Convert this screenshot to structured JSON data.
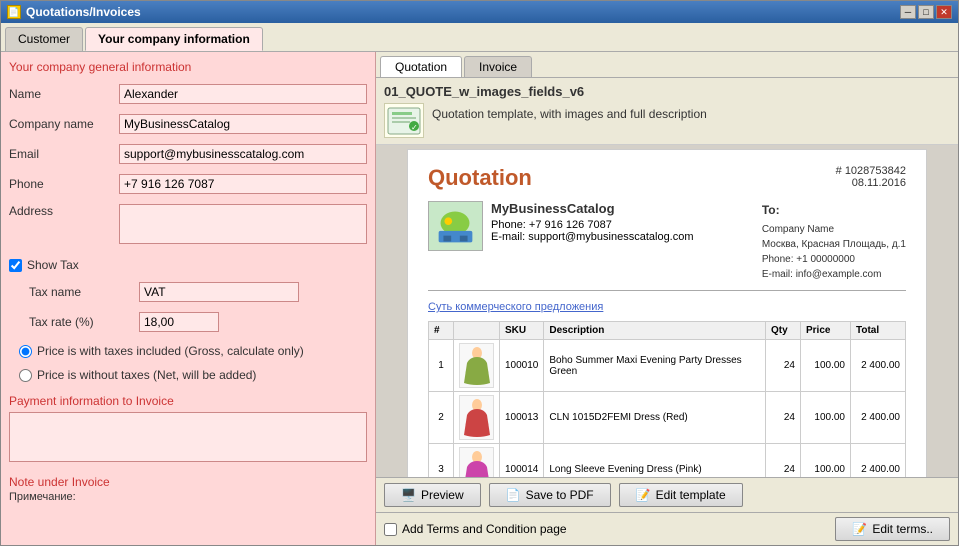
{
  "window": {
    "title": "Quotations/Invoices",
    "icon": "💼"
  },
  "outer_tabs": [
    {
      "label": "Customer",
      "active": false
    },
    {
      "label": "Your company information",
      "active": true
    }
  ],
  "left_panel": {
    "section_title": "Your company general information",
    "fields": [
      {
        "label": "Name",
        "value": "Alexander",
        "placeholder": ""
      },
      {
        "label": "Company name",
        "value": "MyBusinessCatalog",
        "placeholder": ""
      },
      {
        "label": "Email",
        "value": "support@mybusinesscatalog.com",
        "placeholder": ""
      },
      {
        "label": "Phone",
        "value": "+7 916 126 7087",
        "placeholder": ""
      },
      {
        "label": "Address",
        "value": "",
        "placeholder": "",
        "multiline": true
      }
    ],
    "show_tax_label": "Show Tax",
    "show_tax_checked": true,
    "tax_name_label": "Tax name",
    "tax_name_value": "VAT",
    "tax_rate_label": "Tax rate (%)",
    "tax_rate_value": "18,00",
    "radio_options": [
      {
        "label": "Price is with taxes included (Gross, calculate only)",
        "checked": true
      },
      {
        "label": "Price is without taxes (Net, will be added)",
        "checked": false
      }
    ],
    "payment_label": "Payment information to Invoice",
    "payment_value": "",
    "note_label": "Note under Invoice",
    "note_sublabel": "Примечание:"
  },
  "right_panel": {
    "tabs": [
      {
        "label": "Quotation",
        "active": true
      },
      {
        "label": "Invoice",
        "active": false
      }
    ],
    "template_name": "01_QUOTE_w_images_fields_v6",
    "template_description": "Quotation template, with images and full description",
    "document": {
      "title": "Quotation",
      "number": "# 1028753842",
      "date": "08.11.2016",
      "company_name": "MyBusinessCatalog",
      "company_phone": "Phone: +7 916 126 7087",
      "company_email": "E-mail: support@mybusinesscatalog.com",
      "to_label": "To:",
      "to_company": "Company Name",
      "to_address": "Москва, Красная Площадь, д.1",
      "to_phone": "Phone: +1 00000000",
      "to_email": "E-mail: info@example.com",
      "subject": "Суть коммерческого предложения",
      "table_headers": [
        "#",
        "SKU",
        "Description",
        "Qty",
        "Price",
        "Total"
      ],
      "items": [
        {
          "num": "1",
          "sku": "100010",
          "desc": "Boho Summer Maxi Evening Party Dresses Green",
          "qty": "24",
          "price": "100.00",
          "total": "2 400.00"
        },
        {
          "num": "2",
          "sku": "100013",
          "desc": "CLN 1015D2FEMI Dress (Red)",
          "qty": "24",
          "price": "100.00",
          "total": "2 400.00"
        },
        {
          "num": "3",
          "sku": "100014",
          "desc": "Long Sleeve Evening Dress (Pink)",
          "qty": "24",
          "price": "100.00",
          "total": "2 400.00"
        }
      ]
    },
    "buttons": {
      "preview": "Preview",
      "save_pdf": "Save to PDF",
      "edit_template": "Edit template"
    },
    "terms": {
      "checkbox_label": "Add Terms and Condition page",
      "edit_terms": "Edit terms.."
    }
  }
}
